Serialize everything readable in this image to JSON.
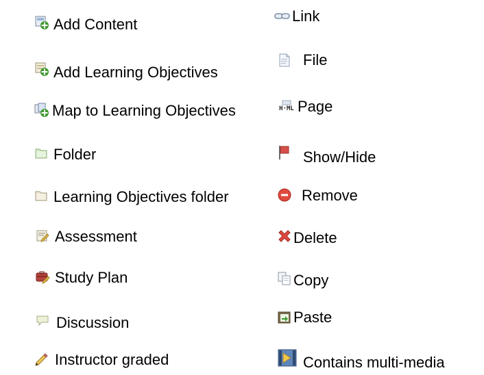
{
  "legend": {
    "left_column": [
      {
        "label": "Add Content",
        "icon": "add-content-icon"
      },
      {
        "label": "Add Learning Objectives",
        "icon": "add-learning-objectives-icon"
      },
      {
        "label": "Map to Learning Objectives",
        "icon": "map-learning-objectives-icon"
      },
      {
        "label": "Folder",
        "icon": "folder-icon"
      },
      {
        "label": "Learning Objectives folder",
        "icon": "learning-objectives-folder-icon"
      },
      {
        "label": "Assessment",
        "icon": "assessment-icon"
      },
      {
        "label": "Study Plan",
        "icon": "study-plan-icon"
      },
      {
        "label": "Discussion",
        "icon": "discussion-icon"
      },
      {
        "label": "Instructor graded",
        "icon": "pencil-icon"
      }
    ],
    "right_column": [
      {
        "label": "Link",
        "icon": "link-icon"
      },
      {
        "label": "File",
        "icon": "file-icon"
      },
      {
        "label": "Page",
        "icon": "html-page-icon"
      },
      {
        "label": "Show/Hide",
        "icon": "flag-icon"
      },
      {
        "label": "Remove",
        "icon": "remove-icon"
      },
      {
        "label": "Delete",
        "icon": "delete-icon"
      },
      {
        "label": "Copy",
        "icon": "copy-icon"
      },
      {
        "label": "Paste",
        "icon": "paste-icon"
      },
      {
        "label": "Contains multi-media",
        "icon": "multimedia-icon"
      }
    ],
    "icon_text": {
      "html_page": "H·ML"
    }
  }
}
